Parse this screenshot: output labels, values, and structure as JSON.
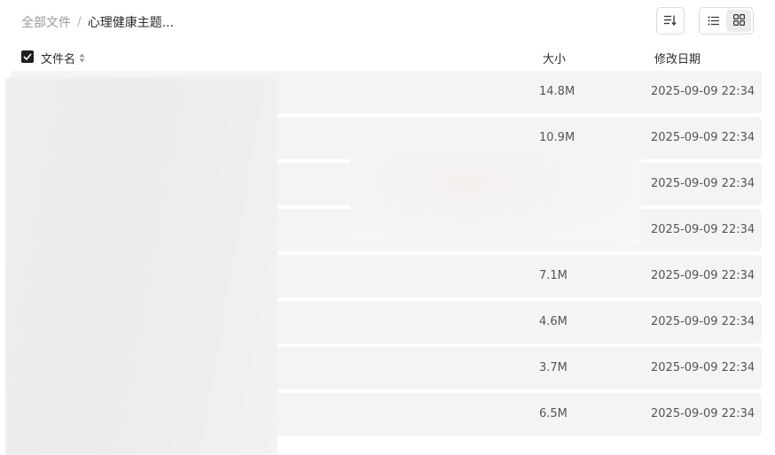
{
  "breadcrumb": {
    "root": "全部文件",
    "separator": "/",
    "current": "心理健康主题..."
  },
  "toolbar": {
    "sort_icon": "sort-icon",
    "list_view_icon": "list-view-icon",
    "grid_view_icon": "grid-view-icon",
    "active_view": "grid"
  },
  "table": {
    "headers": {
      "name": "文件名",
      "size": "大小",
      "modified": "修改日期"
    },
    "select_all_checked": true,
    "rows": [
      {
        "size": "14.8M",
        "date": "2025-09-09 22:34"
      },
      {
        "size": "10.9M",
        "date": "2025-09-09 22:34"
      },
      {
        "size": "",
        "date": "2025-09-09 22:34"
      },
      {
        "size": "",
        "date": "2025-09-09 22:34"
      },
      {
        "size": "7.1M",
        "date": "2025-09-09 22:34"
      },
      {
        "size": "4.6M",
        "date": "2025-09-09 22:34"
      },
      {
        "size": "3.7M",
        "date": "2025-09-09 22:34"
      },
      {
        "size": "6.5M",
        "date": "2025-09-09 22:34"
      }
    ]
  }
}
